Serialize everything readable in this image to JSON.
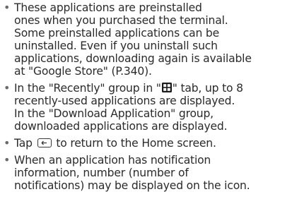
{
  "notes": [
    {
      "bullet": "•",
      "lines": [
        "These applications are preinstalled",
        "ones when you purchased the terminal.",
        "Some preinstalled applications can be",
        "uninstalled. Even if you uninstall such",
        "applications, downloading again is available",
        "at \"Google Store\" (P.340)."
      ]
    },
    {
      "bullet": "•",
      "line1_before_icon": "In the \"Recently\" group in \"",
      "line1_icon": "grid-icon",
      "line1_after_icon": "\" tab, up to 8",
      "lines_rest": [
        "recently-used applications are displayed.",
        "In the \"Download Application\" group,",
        "downloaded applications are displayed."
      ]
    },
    {
      "bullet": "•",
      "before_icon": "Tap ",
      "icon": "back-key-icon",
      "after_icon": " to return to the Home screen."
    },
    {
      "bullet": "•",
      "lines": [
        "When an application has notification",
        "information, number (number of",
        "notifications) may be displayed on the icon."
      ]
    }
  ]
}
